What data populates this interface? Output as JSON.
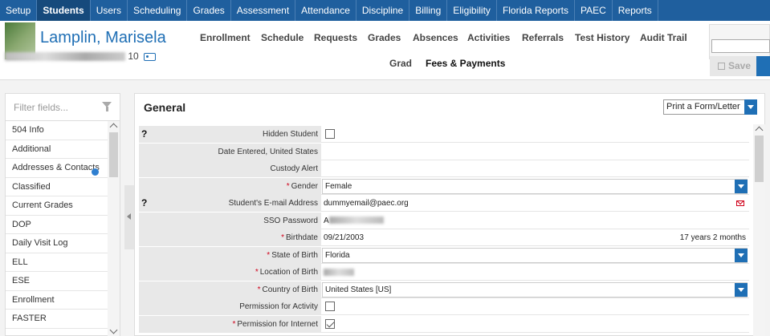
{
  "topnav": [
    "Setup",
    "Students",
    "Users",
    "Scheduling",
    "Grades",
    "Assessment",
    "Attendance",
    "Discipline",
    "Billing",
    "Eligibility",
    "Florida Reports",
    "PAEC",
    "Reports"
  ],
  "student": {
    "name": "Lamplin, Marisela",
    "grade_suffix": "10"
  },
  "tabs_row1": [
    "Enrollment",
    "Schedule",
    "Requests",
    "Grades",
    "Absences",
    "Activities",
    "Referrals",
    "Test History",
    "Audit Trail"
  ],
  "tabs_row2": [
    "Grad",
    "Fees & Payments"
  ],
  "save_label": "Save",
  "sidebar": {
    "filter_placeholder": "Filter fields...",
    "items": [
      "504 Info",
      "Additional",
      "Addresses & Contacts",
      "Classified",
      "Current Grades",
      "DOP",
      "Daily Visit Log",
      "ELL",
      "ESE",
      "Enrollment",
      "FASTER"
    ]
  },
  "main": {
    "title": "General",
    "print_label": "Print a Form/Letter",
    "fields": [
      {
        "label": "Hidden Student",
        "help": "?",
        "type": "checkbox",
        "checked": false
      },
      {
        "label": "Date Entered, United States",
        "type": "text",
        "value": ""
      },
      {
        "label": "Custody Alert",
        "type": "text",
        "value": ""
      },
      {
        "label": "Gender",
        "required": true,
        "type": "select",
        "value": "Female"
      },
      {
        "label": "Student's E-mail Address",
        "help": "?",
        "type": "email",
        "value": "dummyemail@paec.org"
      },
      {
        "label": "SSO Password",
        "type": "masked",
        "value": "A"
      },
      {
        "label": "Birthdate",
        "required": true,
        "type": "date",
        "value": "09/21/2003",
        "extra": "17 years 2 months"
      },
      {
        "label": "State of Birth",
        "required": true,
        "type": "select",
        "value": "Florida"
      },
      {
        "label": "Location of Birth",
        "required": true,
        "type": "masked",
        "value": ""
      },
      {
        "label": "Country of Birth",
        "required": true,
        "type": "select",
        "value": "United States [US]"
      },
      {
        "label": "Permission for Activity",
        "type": "checkbox",
        "checked": false
      },
      {
        "label": "Permission for Internet",
        "required": true,
        "type": "checkbox",
        "checked": true
      }
    ]
  },
  "colors": {
    "nav": "#1f5f9e",
    "accent": "#1f6fb5",
    "required": "#d0021b"
  }
}
